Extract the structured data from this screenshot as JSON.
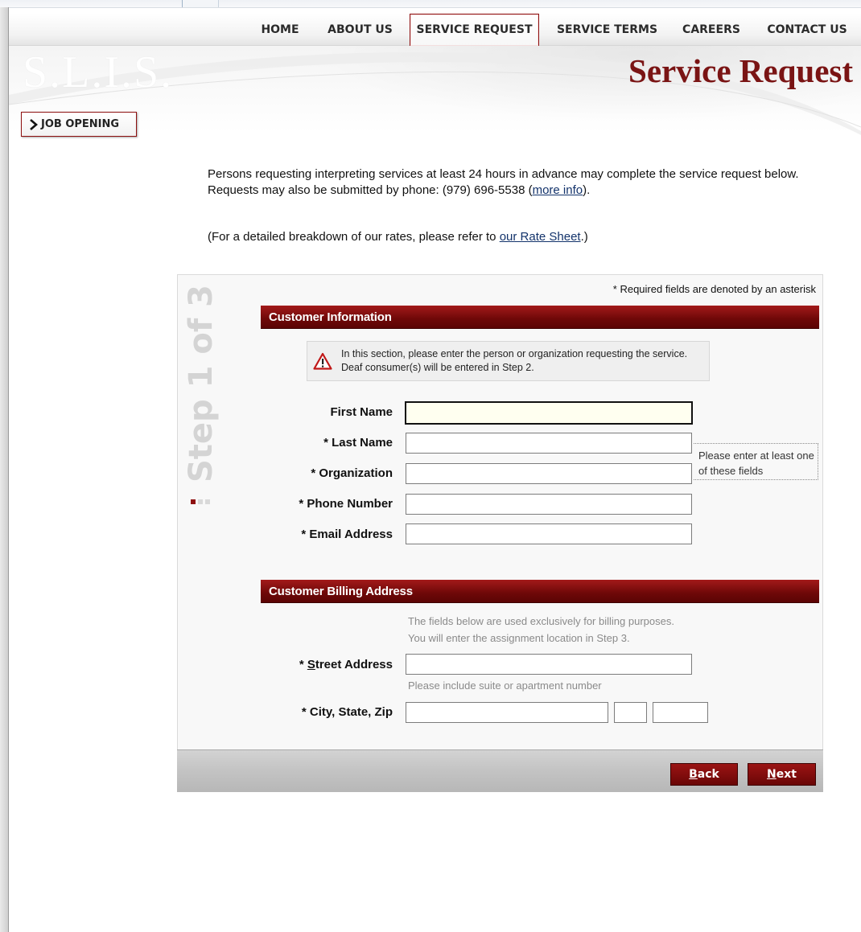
{
  "nav": {
    "items": [
      {
        "label": "HOME"
      },
      {
        "label": "ABOUT US"
      },
      {
        "label": "SERVICE REQUEST",
        "active": true
      },
      {
        "label": "SERVICE TERMS"
      },
      {
        "label": "CAREERS"
      },
      {
        "label": "CONTACT US"
      }
    ]
  },
  "header": {
    "logo_text": "S.L.I.S.",
    "title": "Service Request"
  },
  "sidebar": {
    "job_opening_label": "JOB OPENING"
  },
  "intro": {
    "text_before_link": "Persons requesting interpreting services at least 24 hours in advance may complete the service request below. Requests may also be submitted by phone: (979) 696-5538 (",
    "more_info_link": "more info",
    "text_after_link": ").",
    "rates_before_link": "(For a detailed breakdown of our rates, please refer to ",
    "rates_link": "our Rate Sheet",
    "rates_after_link": ".)"
  },
  "form": {
    "step_label": "Step 1 of 3",
    "required_note": "* Required fields are denoted by an asterisk",
    "customer_info": {
      "header": "Customer Information",
      "notice": "In this section, please enter the person or organization requesting the service. Deaf consumer(s) will be entered in Step 2.",
      "first_name_label": "First Name",
      "first_name_value": "",
      "last_name_label": "* Last Name",
      "last_name_value": "",
      "organization_label": "* Organization",
      "organization_value": "",
      "either_note": "Please enter at least one of these fields",
      "phone_label": "* Phone Number",
      "phone_value": "",
      "email_label": "* Email Address",
      "email_value": ""
    },
    "billing": {
      "header": "Customer Billing Address",
      "note_line1": "The fields below are used exclusively for billing purposes.",
      "note_line2": "You will enter the assignment location in Step 3.",
      "street_label_prefix": "* ",
      "street_label_accesskey": "S",
      "street_label_rest": "treet Address",
      "street_value": "",
      "street_hint": "Please include suite or apartment number",
      "city_state_zip_label": "* City, State, Zip",
      "city_value": "",
      "state_value": "",
      "zip_value": ""
    },
    "buttons": {
      "back_accesskey": "B",
      "back_rest": "ack",
      "next_accesskey": "N",
      "next_rest": "ext"
    }
  },
  "colors": {
    "brand_dark_red": "#7a1414",
    "section_header_red": "#6e0808",
    "focused_field_bg": "#fffff0"
  }
}
